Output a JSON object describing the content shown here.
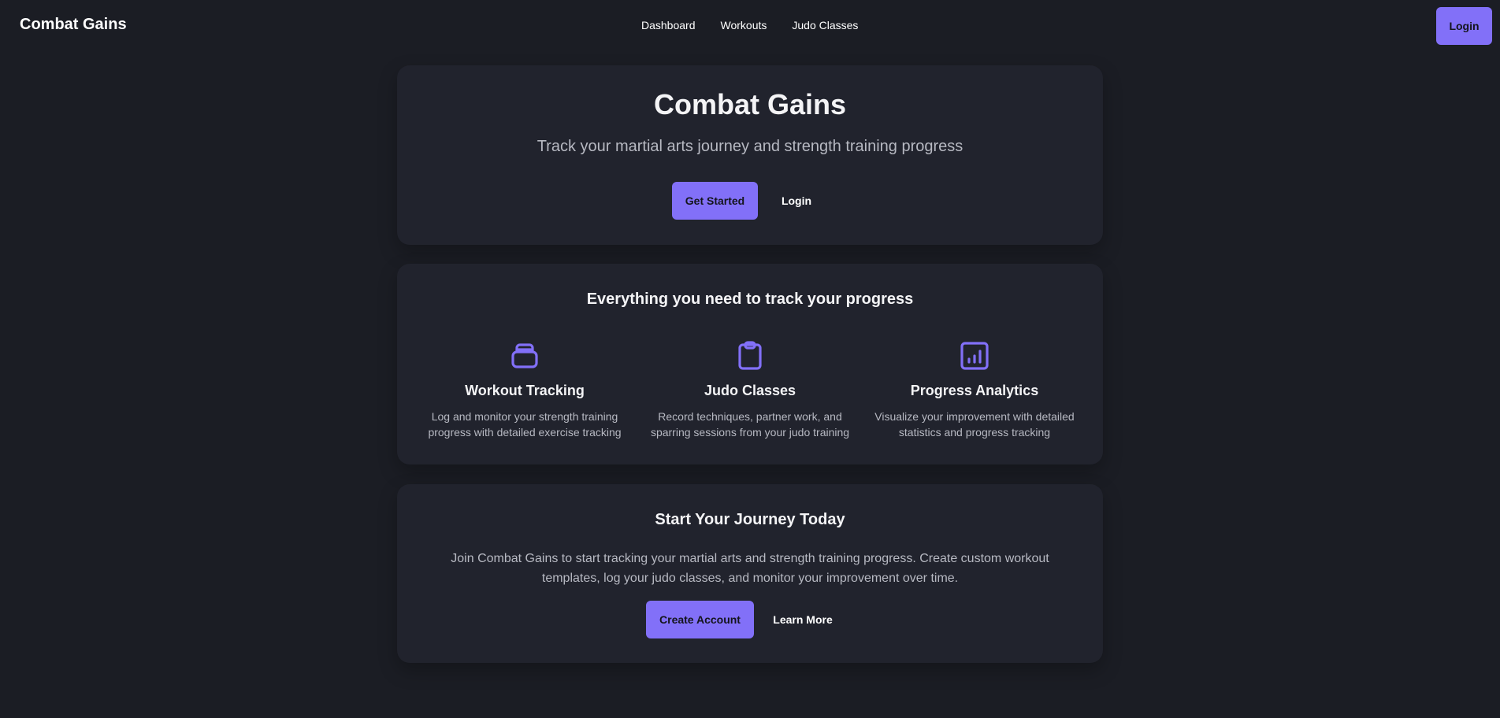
{
  "header": {
    "brand": "Combat Gains",
    "nav": [
      "Dashboard",
      "Workouts",
      "Judo Classes"
    ],
    "login_label": "Login"
  },
  "hero": {
    "title": "Combat Gains",
    "subtitle": "Track your martial arts journey and strength training progress",
    "primary_label": "Get Started",
    "secondary_label": "Login"
  },
  "features": {
    "heading": "Everything you need to track your progress",
    "items": [
      {
        "icon": "kettlebell-icon",
        "title": "Workout Tracking",
        "description": "Log and monitor your strength training progress with detailed exercise tracking"
      },
      {
        "icon": "clipboard-icon",
        "title": "Judo Classes",
        "description": "Record techniques, partner work, and sparring sessions from your judo training"
      },
      {
        "icon": "bar-chart-icon",
        "title": "Progress Analytics",
        "description": "Visualize your improvement with detailed statistics and progress tracking"
      }
    ]
  },
  "cta": {
    "heading": "Start Your Journey Today",
    "text": "Join Combat Gains to start tracking your martial arts and strength training progress. Create custom workout templates, log your judo classes, and monitor your improvement over time.",
    "primary_label": "Create Account",
    "secondary_label": "Learn More"
  },
  "colors": {
    "background": "#1b1d24",
    "card": "#21232d",
    "accent": "#8270f8",
    "text_muted": "#b7b9c2"
  }
}
